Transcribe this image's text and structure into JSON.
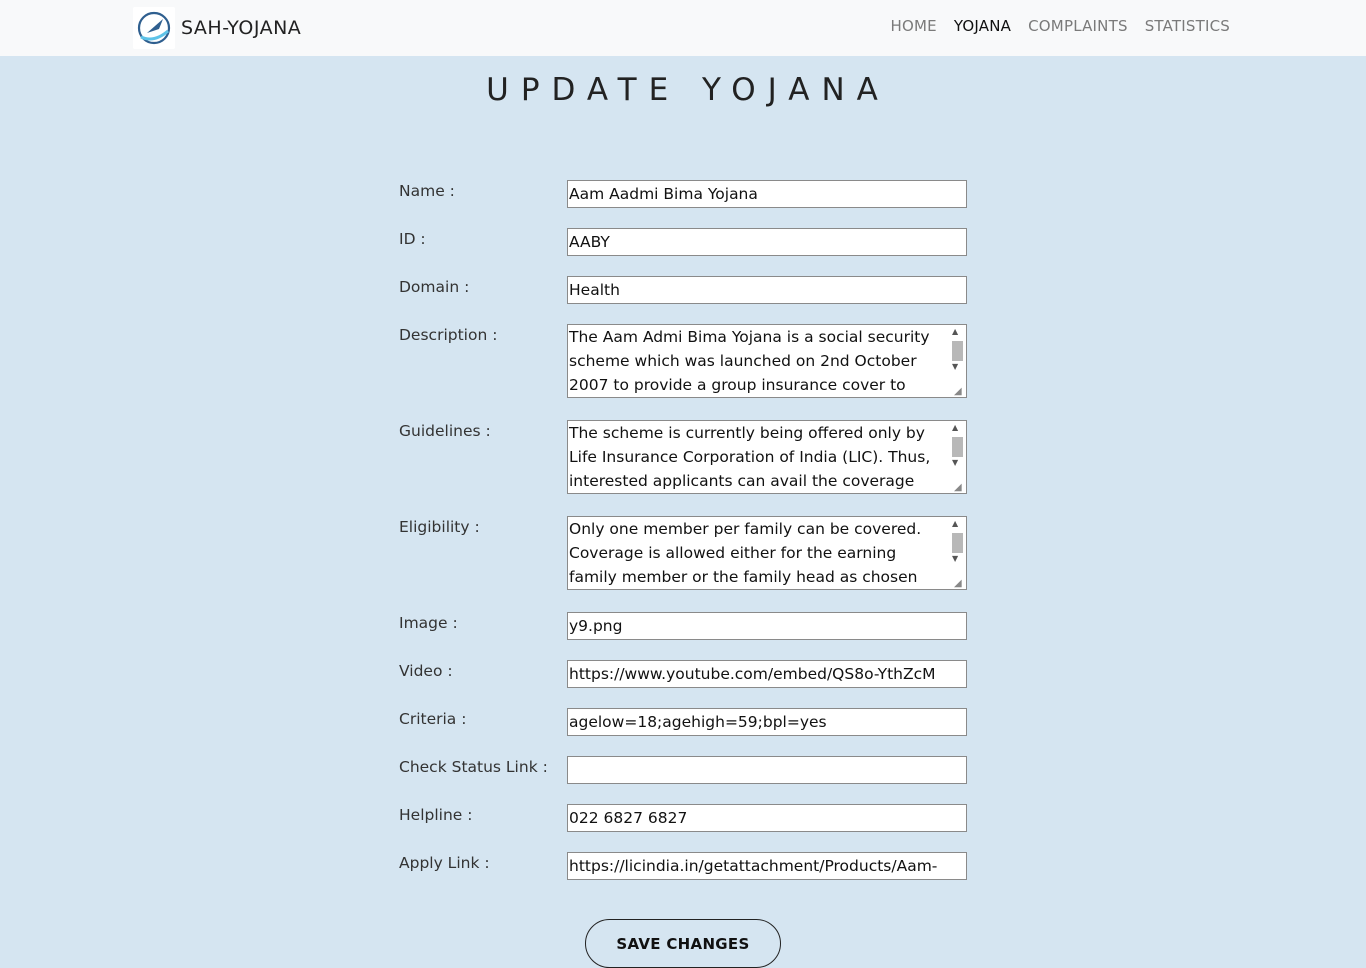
{
  "navbar": {
    "brand": "SAH-YOJANA",
    "links": [
      "HOME",
      "YOJANA",
      "COMPLAINTS",
      "STATISTICS"
    ],
    "active": "YOJANA"
  },
  "page": {
    "title": "UPDATE YOJANA"
  },
  "form": {
    "name": {
      "label": "Name :",
      "value": "Aam Aadmi Bima Yojana"
    },
    "id": {
      "label": "ID :",
      "value": "AABY"
    },
    "domain": {
      "label": "Domain :",
      "value": "Health"
    },
    "description": {
      "label": "Description :",
      "value": "The Aam Admi Bima Yojana is a social security scheme which was launched on 2nd October 2007 to provide a group insurance cover to"
    },
    "guidelines": {
      "label": "Guidelines :",
      "value": "The scheme is currently being offered only by Life Insurance Corporation of India (LIC). Thus, interested applicants can avail the coverage"
    },
    "eligibility": {
      "label": "Eligibility :",
      "value": "Only one member per family can be covered. Coverage is allowed either for the earning family member or the family head as chosen"
    },
    "image": {
      "label": "Image :",
      "value": "y9.png"
    },
    "video": {
      "label": "Video :",
      "value": "https://www.youtube.com/embed/QS8o-YthZcM"
    },
    "criteria": {
      "label": "Criteria :",
      "value": "agelow=18;agehigh=59;bpl=yes"
    },
    "check_status_link": {
      "label": "Check Status Link :",
      "value": ""
    },
    "helpline": {
      "label": "Helpline :",
      "value": "022 6827 6827"
    },
    "apply_link": {
      "label": "Apply Link :",
      "value": "https://licindia.in/getattachment/Products/Aam-"
    }
  },
  "buttons": {
    "save": "SAVE CHANGES"
  },
  "colors": {
    "background": "#d5e5f1",
    "navbar": "#f8f9fa",
    "logo_accent": "#3a9ad9"
  }
}
